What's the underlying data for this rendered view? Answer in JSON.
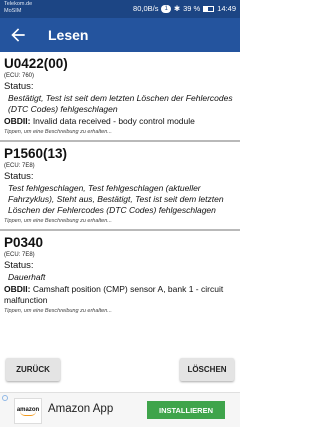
{
  "statusbar": {
    "carrier_line1": "Telekom.de",
    "carrier_line2": "MoSIM",
    "speed": "80,0B/s",
    "badge": "1",
    "battery": "39 %",
    "time": "14:49"
  },
  "appbar": {
    "title": "Lesen"
  },
  "entries": [
    {
      "code": "U0422(00)",
      "ecu": "(ECU: 760)",
      "status_label": "Status:",
      "status_text": "Bestätigt, Test ist seit dem letzten Löschen der Fehlercodes (DTC Codes) fehlgeschlagen",
      "obd_label": "OBDII:",
      "obd_text": " Invalid data received - body control module",
      "hint": "Tippen, um eine Beschreibung zu erhalten..."
    },
    {
      "code": "P1560(13)",
      "ecu": "(ECU: 7E8)",
      "status_label": "Status:",
      "status_text": "Test fehlgeschlagen, Test fehlgeschlagen (aktueller Fahrzyklus), Steht aus, Bestätigt, Test ist seit dem letzten Löschen der Fehlercodes (DTC Codes) fehlgeschlagen",
      "obd_label": "",
      "obd_text": "",
      "hint": "Tippen, um eine Beschreibung zu erhalten..."
    },
    {
      "code": "P0340",
      "ecu": "(ECU: 7E8)",
      "status_label": "Status:",
      "status_text": "Dauerhaft",
      "obd_label": "OBDII:",
      "obd_text": " Camshaft position (CMP) sensor A, bank 1 - circuit malfunction",
      "hint": "Tippen, um eine Beschreibung zu erhalten..."
    }
  ],
  "buttons": {
    "back": "ZURÜCK",
    "delete": "LÖSCHEN"
  },
  "ad": {
    "logo_text": "amazon",
    "title": "Amazon App",
    "install": "INSTALLIEREN"
  },
  "colors": {
    "statusbar": "#1c4584",
    "appbar": "#24549e",
    "install_button": "#3fa44b"
  }
}
